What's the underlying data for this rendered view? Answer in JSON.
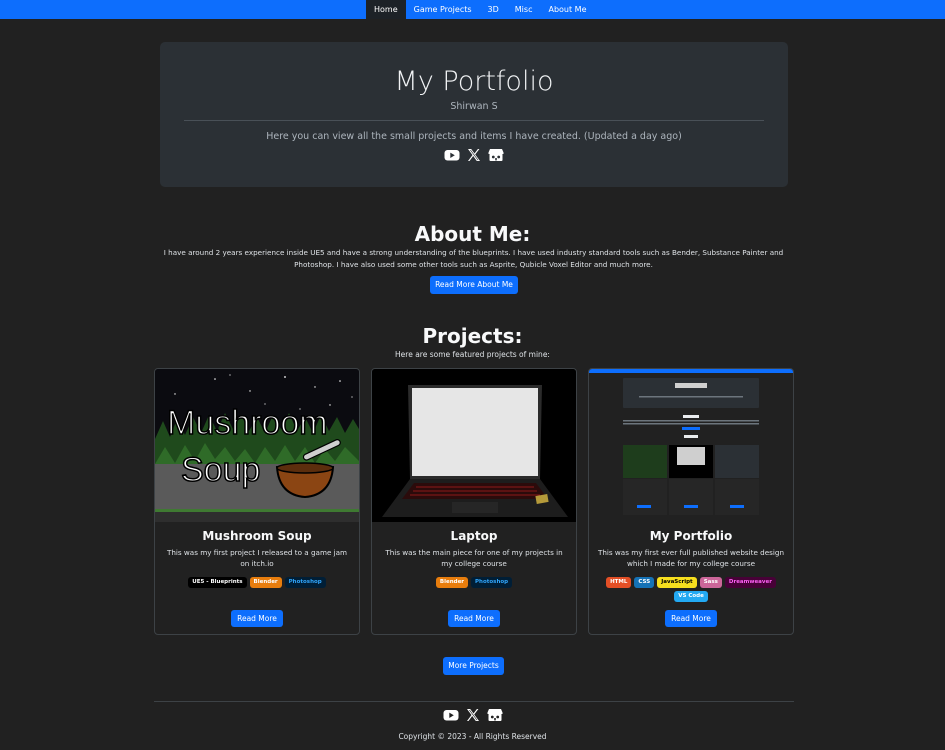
{
  "nav": {
    "items": [
      "Home",
      "Game Projects",
      "3D",
      "Misc",
      "About Me"
    ],
    "active": "Home",
    "color": "#0d6efd"
  },
  "hero": {
    "title": "My Portfolio",
    "author": "Shirwan S",
    "description": "Here you can view all the small projects and items I have created. (Updated a day ago)",
    "social": [
      "youtube-icon",
      "x-icon",
      "itchio-icon"
    ]
  },
  "about": {
    "heading": "About Me:",
    "text": "I have around 2 years experience inside UE5 and have a strong understanding of the blueprints. I have used industry standard tools such as Bender, Substance Painter and Photoshop. I have also used some other tools such as Asprite, Qubicle Voxel Editor and much more.",
    "button": "Read More About Me"
  },
  "projects": {
    "heading": "Projects:",
    "intro": "Here are some featured projects of mine:",
    "cards": [
      {
        "title": "Mushroom Soup",
        "text": "This was my first project I released to a game jam on itch.io",
        "tags": [
          {
            "label": "UE5 - Blueprints",
            "color": "#000000",
            "text": "#ffffff"
          },
          {
            "label": "Blender",
            "color": "#e87d0d",
            "text": "#ffffff"
          },
          {
            "label": "Photoshop",
            "color": "#001e36",
            "text": "#31a8ff"
          }
        ],
        "button": "Read More",
        "image_text": [
          "Mushroom",
          "Soup"
        ]
      },
      {
        "title": "Laptop",
        "text": "This was the main piece for one of my projects in my college course",
        "tags": [
          {
            "label": "Blender",
            "color": "#e87d0d",
            "text": "#ffffff"
          },
          {
            "label": "Photoshop",
            "color": "#001e36",
            "text": "#31a8ff"
          }
        ],
        "button": "Read More"
      },
      {
        "title": "My Portfolio",
        "text": "This was my first ever full published website design which I made for my college course",
        "tags": [
          {
            "label": "HTML",
            "color": "#e34f26",
            "text": "#ffffff"
          },
          {
            "label": "CSS",
            "color": "#1572b6",
            "text": "#ffffff"
          },
          {
            "label": "JavaScript",
            "color": "#f7df1e",
            "text": "#000000"
          },
          {
            "label": "Sass",
            "color": "#cc6699",
            "text": "#ffffff"
          },
          {
            "label": "Dreamweaver",
            "color": "#470137",
            "text": "#ff61f6"
          },
          {
            "label": "VS Code",
            "color": "#23a9f2",
            "text": "#ffffff"
          }
        ],
        "button": "Read More"
      }
    ],
    "more_button": "More Projects"
  },
  "footer": {
    "social": [
      "youtube-icon",
      "x-icon",
      "itchio-icon"
    ],
    "copyright": "Copyright © 2023 - All Rights Reserved"
  },
  "colors": {
    "background": "#212121",
    "hero_bg": "#2b3035",
    "accent": "#0d6efd"
  }
}
